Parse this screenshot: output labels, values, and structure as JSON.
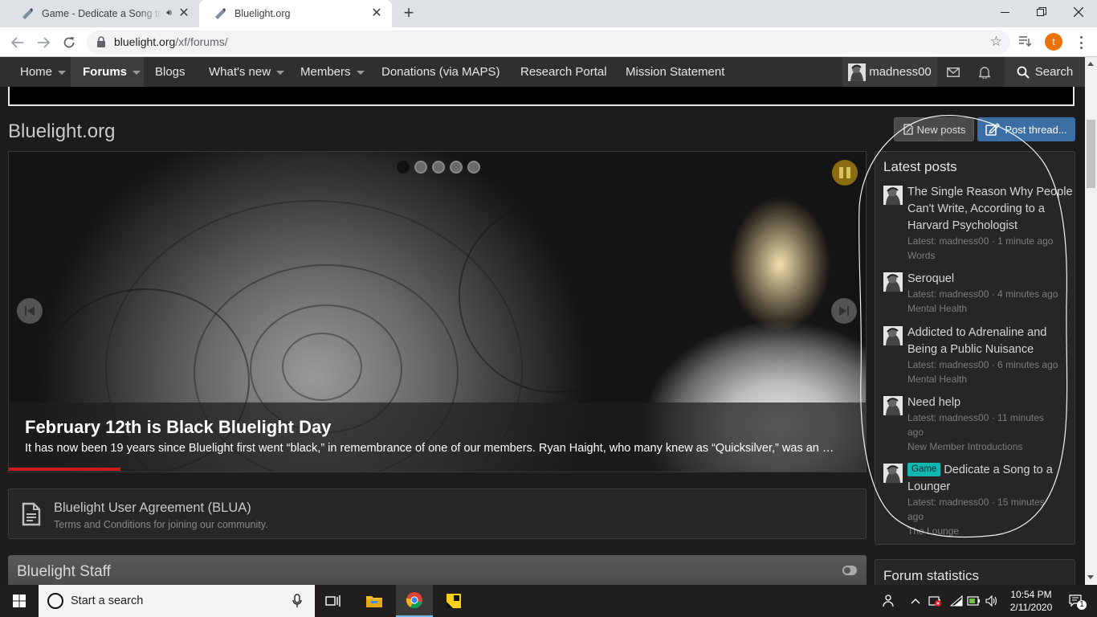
{
  "browser": {
    "tabs": [
      {
        "title": "Game - Dedicate a Song to a Lounger",
        "active": false,
        "audio": true
      },
      {
        "title": "Bluelight.org",
        "active": true
      }
    ],
    "url_host": "bluelight.org",
    "url_path": "/xf/forums/",
    "profile_initial": "t"
  },
  "nav": {
    "items": [
      {
        "label": "Home",
        "caret": true
      },
      {
        "label": "Forums",
        "caret": true,
        "selected": true
      },
      {
        "label": "Blogs",
        "caret": false
      },
      {
        "label": "What's new",
        "caret": true
      },
      {
        "label": "Members",
        "caret": true
      },
      {
        "label": "Donations (via MAPS)",
        "caret": false
      },
      {
        "label": "Research Portal",
        "caret": false
      },
      {
        "label": "Mission Statement",
        "caret": false
      }
    ],
    "username": "madness00",
    "search_label": "Search"
  },
  "page": {
    "title": "Bluelight.org",
    "new_posts_label": "New posts",
    "post_thread_label": "Post thread..."
  },
  "slider": {
    "slide_count": 5,
    "active_index": 0,
    "caption_title": "February 12th is Black Bluelight Day",
    "caption_text": "It has now been 19 years since Bluelight first went “black,” in remembrance of one of our members. Ryan Haight, who many knew as “Quicksilver,” was an …",
    "progress": 0.13,
    "accent_color": "#d21a1a"
  },
  "agreement": {
    "title": "Bluelight User Agreement (BLUA)",
    "description": "Terms and Conditions for joining our community."
  },
  "staff_section": {
    "title": "Bluelight Staff"
  },
  "latest_posts": {
    "title": "Latest posts",
    "items": [
      {
        "title": "The Single Reason Why People Can't Write, According to a Harvard Psychologist",
        "badge": "",
        "latest": "Latest: madness00 · 1 minute ago",
        "forum": "Words"
      },
      {
        "title": "Seroquel",
        "badge": "",
        "latest": "Latest: madness00 · 4 minutes ago",
        "forum": "Mental Health"
      },
      {
        "title": "Addicted to Adrenaline and Being a Public Nuisance",
        "badge": "",
        "latest": "Latest: madness00 · 6 minutes ago",
        "forum": "Mental Health"
      },
      {
        "title": "Need help",
        "badge": "",
        "latest": "Latest: madness00 · 11 minutes ago",
        "forum": "New Member Introductions"
      },
      {
        "title": "Dedicate a Song to a Lounger",
        "badge": "Game",
        "latest": "Latest: madness00 · 15 minutes ago",
        "forum": "The Lounge"
      }
    ]
  },
  "forum_statistics": {
    "title": "Forum statistics"
  },
  "taskbar": {
    "search_placeholder": "Start a search",
    "time": "10:54 PM",
    "date": "2/11/2020",
    "notification_count": "1"
  }
}
